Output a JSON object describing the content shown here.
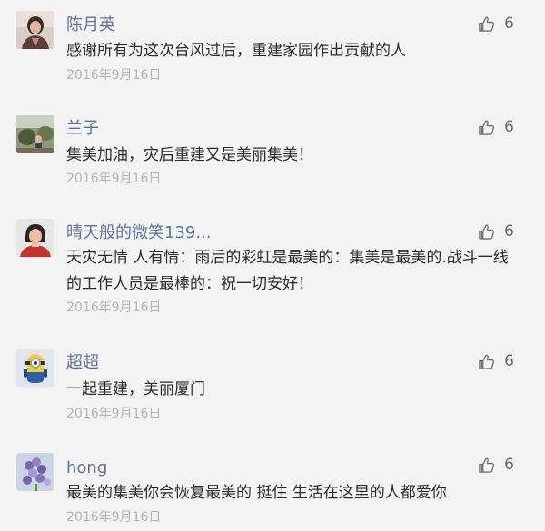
{
  "comments": [
    {
      "name": "陈月英",
      "content": "感谢所有为这次台风过后，重建家园作出贡献的人",
      "date": "2016年9月16日",
      "likes": "6",
      "avatar_icon": "woman-portrait-avatar"
    },
    {
      "name": "兰子",
      "content": "集美加油，灾后重建又是美丽集美！",
      "date": "2016年9月16日",
      "likes": "6",
      "avatar_icon": "outdoor-photo-avatar"
    },
    {
      "name": "晴天般的微笑139...",
      "content": "天灾无情 人有情：雨后的彩虹是最美的：集美是最美的.战斗一线的工作人员是最棒的：祝一切安好！",
      "date": "2016年9月16日",
      "likes": "6",
      "avatar_icon": "woman-red-shirt-avatar"
    },
    {
      "name": "超超",
      "content": "一起重建，美丽厦门",
      "date": "2016年9月16日",
      "likes": "6",
      "avatar_icon": "minion-toy-avatar"
    },
    {
      "name": "hong",
      "content": "最美的集美你会恢复最美的  挺住 生活在这里的人都爱你",
      "date": "2016年9月16日",
      "likes": "6",
      "avatar_icon": "hyacinth-flower-avatar"
    }
  ],
  "colors": {
    "name": "#5f7396",
    "content": "#2b2b2b",
    "date": "#b4b4b4",
    "background": "#f3f3f3"
  }
}
